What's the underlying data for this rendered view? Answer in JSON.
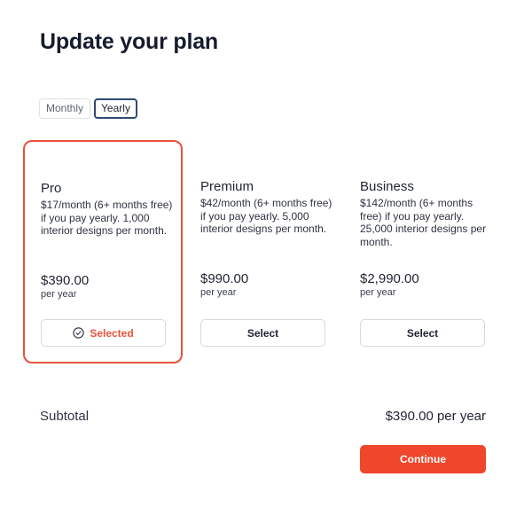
{
  "page": {
    "title": "Update your plan"
  },
  "billing_toggle": {
    "monthly_label": "Monthly",
    "yearly_label": "Yearly",
    "selected": "Yearly"
  },
  "plans": [
    {
      "name": "Pro",
      "description": "$17/month (6+ months free) if you pay yearly. 1,000 interior designs per month.",
      "price": "$390.00",
      "period": "per year",
      "button_label": "Selected",
      "button_icon": "check-circle-icon",
      "selected": true
    },
    {
      "name": "Premium",
      "description": "$42/month (6+ months free) if you pay yearly. 5,000 interior designs per month.",
      "price": "$990.00",
      "period": "per year",
      "button_label": "Select",
      "selected": false
    },
    {
      "name": "Business",
      "description": "$142/month (6+ months free) if you pay yearly. 25,000 interior designs per month.",
      "price": "$2,990.00",
      "period": "per year",
      "button_label": "Select",
      "selected": false
    }
  ],
  "summary": {
    "subtotal_label": "Subtotal",
    "subtotal_value": "$390.00 per year"
  },
  "actions": {
    "continue_label": "Continue"
  },
  "colors": {
    "accent": "#f0462b",
    "selected_border": "#e8533a",
    "toggle_active_border": "#2f4a73",
    "title_text": "#161b2e"
  }
}
